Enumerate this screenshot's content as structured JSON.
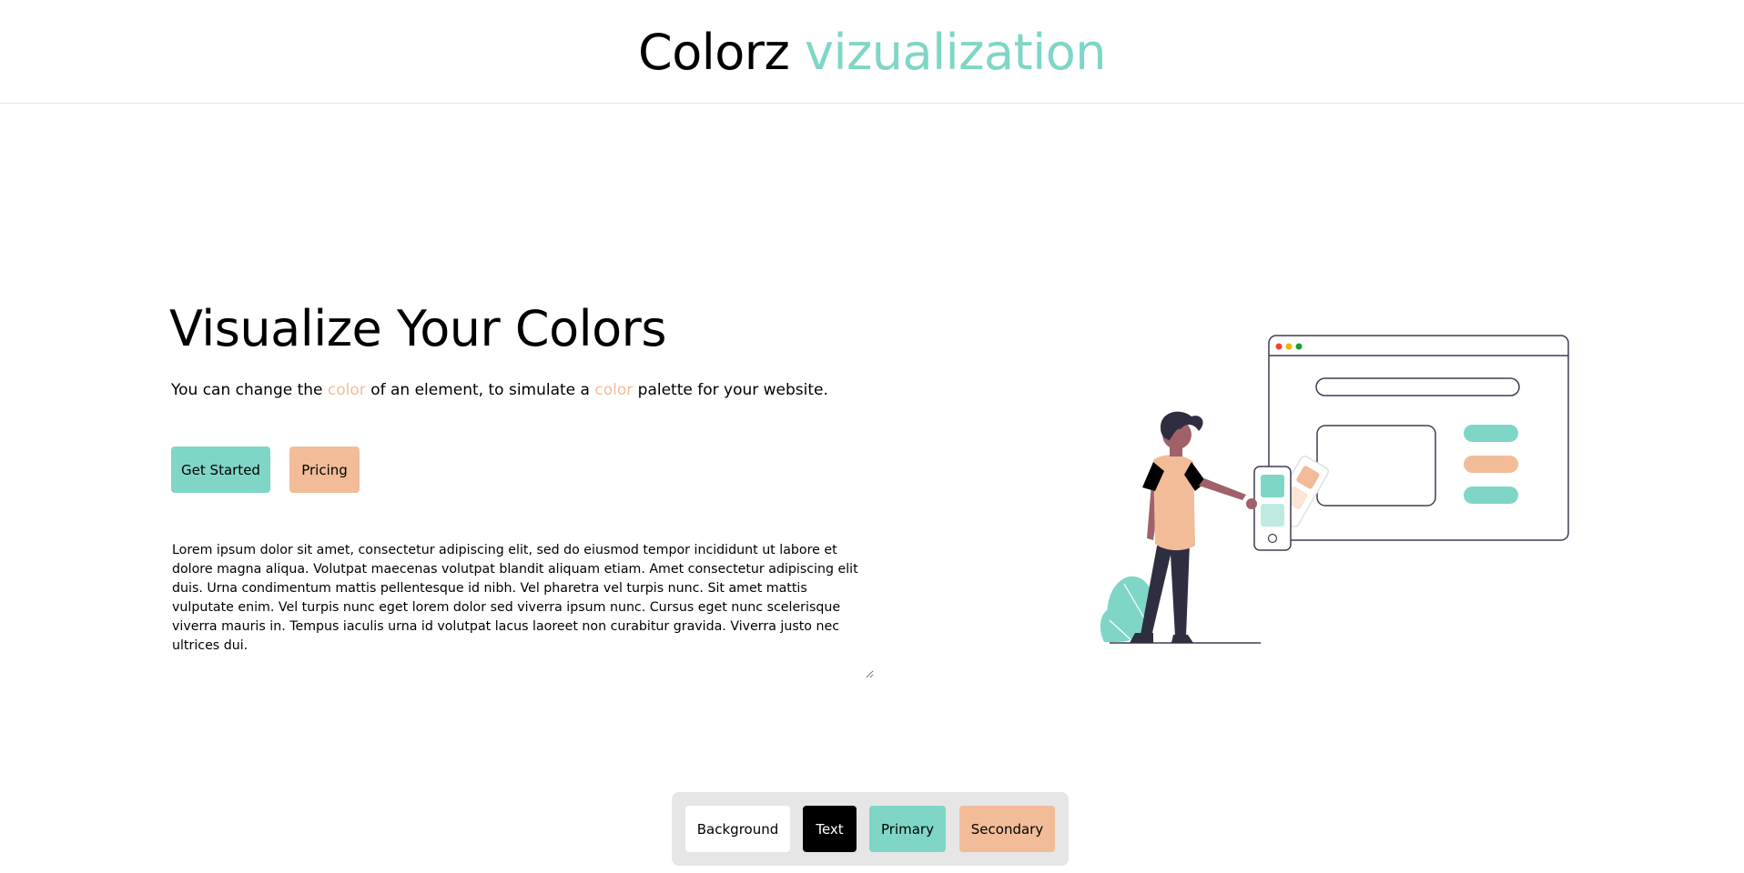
{
  "header": {
    "brand_main": "Colorz",
    "brand_accent": "vizualization"
  },
  "hero": {
    "title": "Visualize Your Colors",
    "subtitle": {
      "part1": "You can change the ",
      "highlight1": "color",
      "part2": " of an element, to simulate a ",
      "highlight2": "color",
      "part3": " palette for your website."
    },
    "buttons": {
      "get_started": "Get Started",
      "pricing": "Pricing"
    },
    "textarea_value": "Lorem ipsum dolor sit amet, consectetur adipiscing elit, sed do eiusmod tempor incididunt ut labore et dolore magna aliqua. Volutpat maecenas volutpat blandit aliquam etiam. Amet consectetur adipiscing elit duis. Urna condimentum mattis pellentesque id nibh. Vel pharetra vel turpis nunc. Sit amet mattis vulputate enim. Vel turpis nunc eget lorem dolor sed viverra ipsum nunc. Cursus eget nunc scelerisque viverra mauris in. Tempus iaculis urna id volutpat lacus laoreet non curabitur gravida. Viverra justo nec ultrices dui."
  },
  "palette": {
    "background_label": "Background",
    "text_label": "Text",
    "primary_label": "Primary",
    "secondary_label": "Secondary"
  },
  "colors": {
    "background": "#ffffff",
    "text": "#000000",
    "primary": "#7fd6c6",
    "secondary": "#f2bc99"
  }
}
